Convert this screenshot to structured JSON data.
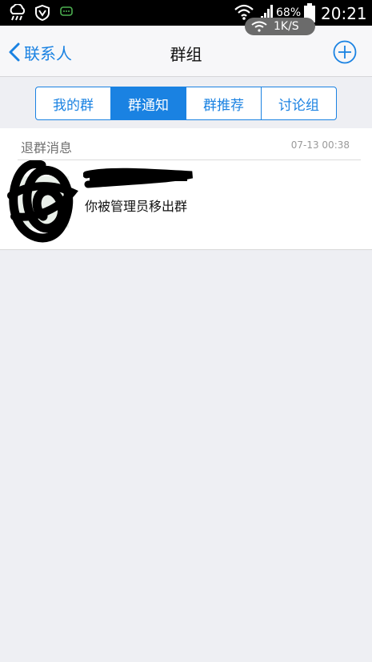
{
  "status_bar": {
    "battery_percent": "68%",
    "time": "20:21",
    "net_speed": "1K/S"
  },
  "nav": {
    "back_label": "联系人",
    "title": "群组"
  },
  "tabs": [
    {
      "label": "我的群",
      "active": false
    },
    {
      "label": "群通知",
      "active": true
    },
    {
      "label": "群推荐",
      "active": false
    },
    {
      "label": "讨论组",
      "active": false
    }
  ],
  "section": {
    "title": "退群消息",
    "timestamp": "07-13 00:38"
  },
  "notice": {
    "message": "你被管理员移出群"
  },
  "colors": {
    "accent": "#1a82e2",
    "background": "#eeeff3"
  }
}
